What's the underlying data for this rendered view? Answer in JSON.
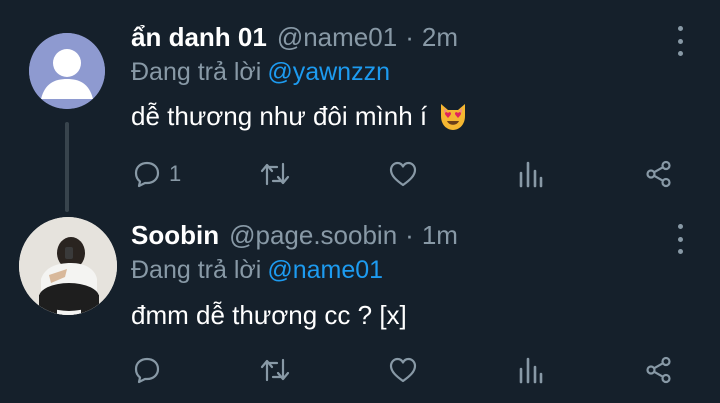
{
  "tweets": [
    {
      "name": "ẩn danh 01",
      "handle": "@name01",
      "dot": "·",
      "time": "2m",
      "replying_prefix": "Đang trả lời",
      "replying_to": "@yawnzzn",
      "text": "dễ thương như đôi mình í",
      "emoji": "smiling-cat-heart-eyes",
      "avatar": "default-avatar",
      "reply_count": "1"
    },
    {
      "name": "Soobin",
      "handle": "@page.soobin",
      "dot": "·",
      "time": "1m",
      "replying_prefix": "Đang trả lời",
      "replying_to": "@name01",
      "text": "đmm dễ thương cc ? [x]",
      "avatar": "photo-avatar",
      "reply_count": ""
    }
  ],
  "colors": {
    "background": "#15202b",
    "secondary_text": "#8899a6",
    "link": "#1d9bf0",
    "thread_line": "#38444d"
  },
  "icons": [
    "reply-icon",
    "retweet-icon",
    "like-icon",
    "analytics-icon",
    "share-icon",
    "more-icon"
  ]
}
